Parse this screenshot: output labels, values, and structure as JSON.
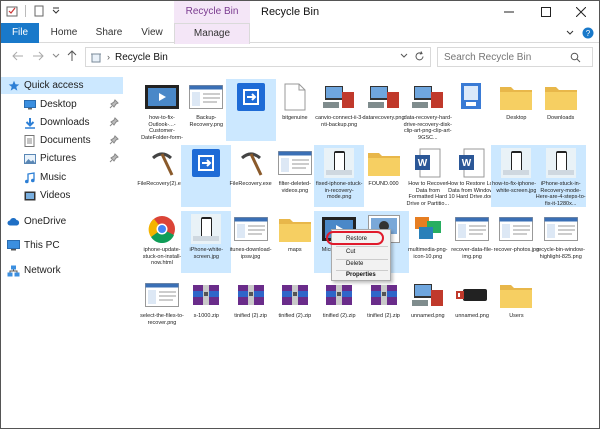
{
  "window": {
    "title": "Recycle Bin",
    "context_tab_title": "Recycle Bin Tools"
  },
  "ribbon": {
    "tabs": [
      "File",
      "Home",
      "Share",
      "View",
      "Manage"
    ]
  },
  "address": {
    "path": "Recycle Bin",
    "search_placeholder": "Search Recycle Bin"
  },
  "navpane": {
    "items": [
      {
        "label": "Quick access",
        "icon": "star-icon",
        "pinned": false
      },
      {
        "label": "Desktop",
        "icon": "desktop-icon",
        "pinned": true
      },
      {
        "label": "Downloads",
        "icon": "download-icon",
        "pinned": true
      },
      {
        "label": "Documents",
        "icon": "documents-icon",
        "pinned": true
      },
      {
        "label": "Pictures",
        "icon": "pictures-icon",
        "pinned": true
      },
      {
        "label": "Music",
        "icon": "music-icon",
        "pinned": false
      },
      {
        "label": "Videos",
        "icon": "videos-icon",
        "pinned": false
      },
      {
        "label": "OneDrive",
        "icon": "cloud-icon",
        "pinned": false
      },
      {
        "label": "This PC",
        "icon": "pc-icon",
        "pinned": false
      },
      {
        "label": "Network",
        "icon": "network-icon",
        "pinned": false
      }
    ]
  },
  "files": [
    {
      "label": "how-to-fix-Outlook-...-Customer-DateFolder-form-2.mp4",
      "kind": "video"
    },
    {
      "label": "Backup-Recovery.png",
      "kind": "screenshot"
    },
    {
      "label": "",
      "kind": "appicon"
    },
    {
      "label": "bitgenuine",
      "kind": "doc"
    },
    {
      "label": "canvio-connect-ii-3-nti-backup.png",
      "kind": "devices"
    },
    {
      "label": "datarecovery.png",
      "kind": "devices"
    },
    {
      "label": "data-recovery-hard-drive-recovery-disk-clip-art-png-clip-art-9GSC...",
      "kind": "devices"
    },
    {
      "label": "",
      "kind": "installer"
    },
    {
      "label": "Desktop",
      "kind": "folder"
    },
    {
      "label": "Downloads",
      "kind": "folder"
    },
    {
      "label": "FileRecovery(2).exe",
      "kind": "pickaxe"
    },
    {
      "label": "",
      "kind": "appicon"
    },
    {
      "label": "FileRecovery.exe",
      "kind": "pickaxe"
    },
    {
      "label": "filter-deleted-videos.png",
      "kind": "screenshot"
    },
    {
      "label": "fixed-iphone-stuck-in-recovery-mode.png",
      "kind": "phone"
    },
    {
      "label": "FOUND.000",
      "kind": "folder"
    },
    {
      "label": "How to Recover Data from Formatted Hard Drive or Partitio...",
      "kind": "word"
    },
    {
      "label": "How to Restore Lost Data from Windows 10 Hard Drive.docx",
      "kind": "word"
    },
    {
      "label": "how-to-fix-iphone-s-white-screen.jpg",
      "kind": "phone"
    },
    {
      "label": "iPhone-stuck-in-Recovery-mode-Here-are-4-steps-to-fix-it-1280x...",
      "kind": "phone"
    },
    {
      "label": "iphone-update-stuck-on-install-now.html",
      "kind": "chrome"
    },
    {
      "label": "iPhone-white-screen.jpg",
      "kind": "phone"
    },
    {
      "label": "itunes-download-ipsw.jpg",
      "kind": "screenshot"
    },
    {
      "label": "maps",
      "kind": "folder"
    },
    {
      "label": "Micro...-Pro-...",
      "kind": "video"
    },
    {
      "label": "",
      "kind": "photo"
    },
    {
      "label": "multimedia-png-icon-10.png",
      "kind": "multimedia"
    },
    {
      "label": "recover-data-file-img.png",
      "kind": "screenshot"
    },
    {
      "label": "recover-photos.jpg",
      "kind": "screenshot"
    },
    {
      "label": "recycle-bin-window-highlight-825.png",
      "kind": "screenshot"
    },
    {
      "label": "select-the-files-to-recover.png",
      "kind": "screenshot"
    },
    {
      "label": "s-1000.zip",
      "kind": "zip"
    },
    {
      "label": "tinified (2).zip",
      "kind": "zip"
    },
    {
      "label": "tinified (2).zip",
      "kind": "zip"
    },
    {
      "label": "tinified (2).zip",
      "kind": "zip"
    },
    {
      "label": "tinified (2).zip",
      "kind": "zip"
    },
    {
      "label": "unnamed.png",
      "kind": "devices"
    },
    {
      "label": "unnamed.png",
      "kind": "usb"
    },
    {
      "label": "Users",
      "kind": "folder"
    }
  ],
  "context_menu": {
    "items": [
      "Restore",
      "Cut",
      "Delete",
      "Properties"
    ]
  },
  "colors": {
    "file_tab": "#1979ca",
    "context_tab": "#f4e6f7",
    "context_tab_text": "#7b3b90",
    "selection": "#cce8ff",
    "highlight_ring": "#e01a2c"
  }
}
